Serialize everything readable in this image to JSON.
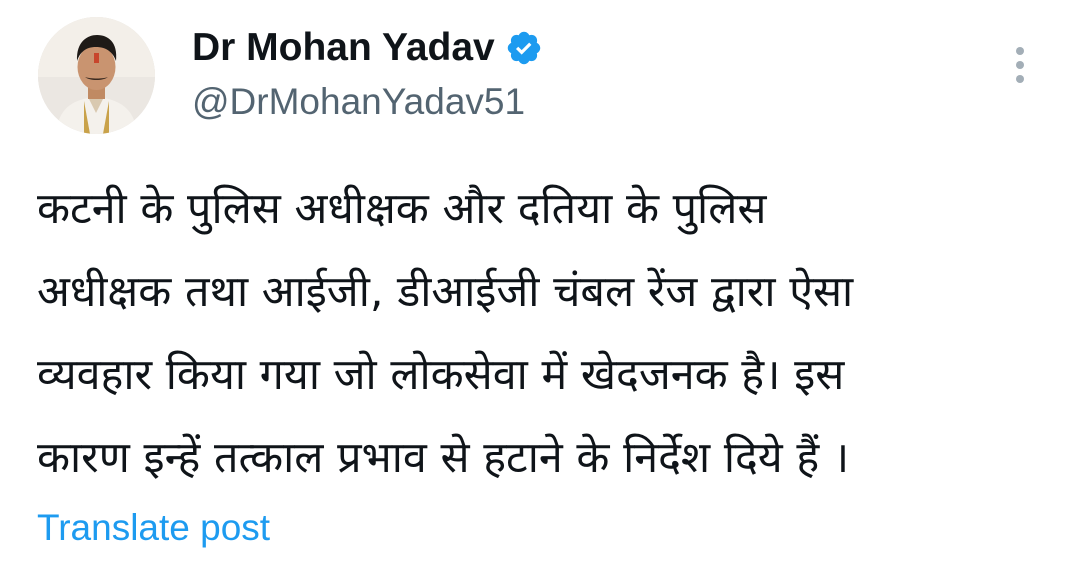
{
  "author": {
    "display_name": "Dr Mohan Yadav",
    "handle": "@DrMohanYadav51",
    "verified": true,
    "verified_icon": "verified-badge-icon",
    "verified_color": "#1d9bf0",
    "avatar_icon": "profile-photo"
  },
  "tweet": {
    "lines": [
      "कटनी के पुलिस अधीक्षक और दतिया के पुलिस",
      "अधीक्षक तथा आईजी, डीआईजी चंबल रेंज द्वारा ऐसा",
      "व्यवहार किया गया जो लोकसेवा में खेदजनक है। इस",
      "कारण इन्हें तत्काल प्रभाव से हटाने के निर्देश दिये हैं ।"
    ]
  },
  "actions": {
    "translate_label": "Translate post",
    "translate_color": "#1d9bf0",
    "more_icon": "more-vertical-icon"
  }
}
